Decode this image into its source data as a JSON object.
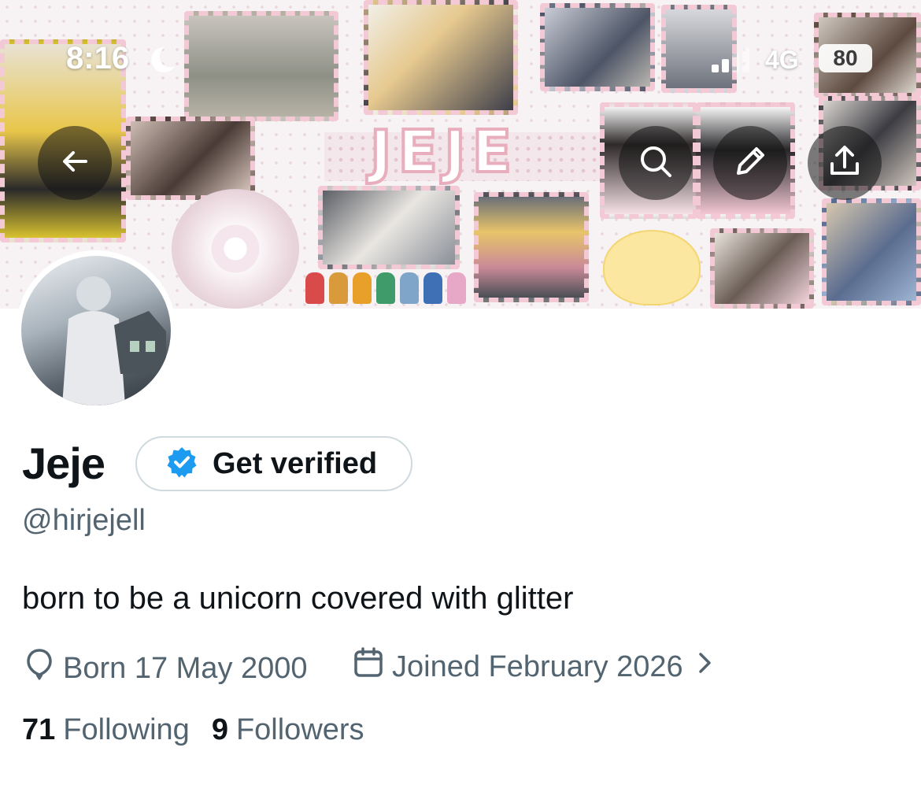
{
  "status_bar": {
    "time": "8:16",
    "network": "4G",
    "battery": "80"
  },
  "banner": {
    "title_text": "JEJE"
  },
  "profile": {
    "name": "Jeje",
    "verify_label": "Get verified",
    "handle": "@hirjejell",
    "bio": "born to be a unicorn covered with glitter",
    "birthday": "Born 17 May 2000",
    "joined": "Joined February 2026",
    "following_count": "71",
    "following_label": "Following",
    "followers_count": "9",
    "followers_label": "Followers"
  },
  "colors": {
    "text_primary": "#0f1419",
    "text_secondary": "#536471",
    "verified_blue": "#1d9bf0",
    "border": "#cfd9de",
    "banner_pink": "#f2c9d4"
  },
  "icons": [
    "back-arrow-icon",
    "search-icon",
    "pencil-icon",
    "share-icon",
    "verified-badge-icon",
    "balloon-icon",
    "calendar-icon",
    "chevron-right-icon",
    "moon-icon",
    "signal-icon"
  ]
}
